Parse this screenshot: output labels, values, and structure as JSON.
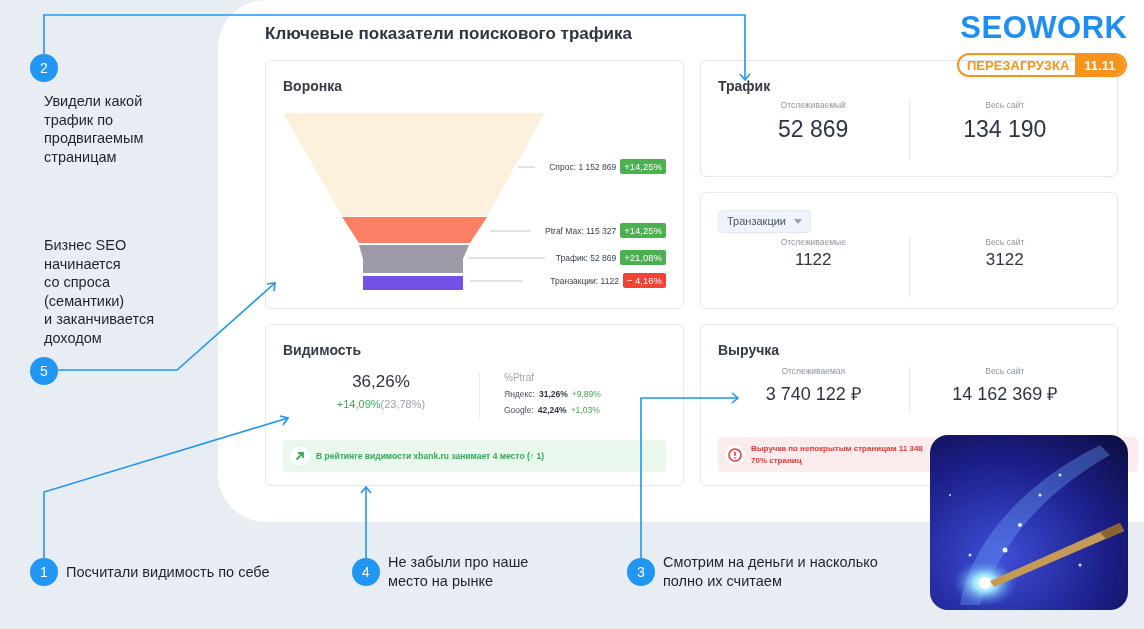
{
  "page_title": "Ключевые показатели поискового трафика",
  "logo": {
    "name": "SEOWORK",
    "badge_label": "ПЕРЕЗАГРУЗКА",
    "badge_date": "11.11"
  },
  "funnel": {
    "title": "Воронка",
    "stages": [
      {
        "label": "Спрос:",
        "value": "1 152 869",
        "change": "+14,25%",
        "negative": false,
        "color": "#fdf1de"
      },
      {
        "label": "Ptraf Max:",
        "value": "115 327",
        "change": "+14,25%",
        "negative": false,
        "color": "#fd7f66"
      },
      {
        "label": "Трафик:",
        "value": "52 869",
        "change": "+21,08%",
        "negative": false,
        "color": "#9e9aa8"
      },
      {
        "label": "Транзакции:",
        "value": "1122",
        "change": "− 4,16%",
        "negative": true,
        "color": "#7350e6"
      }
    ]
  },
  "traffic": {
    "title": "Трафик",
    "metrics": [
      {
        "label": "Отслеживаемый",
        "value": "52 869"
      },
      {
        "label": "Весь сайт",
        "value": "134 190"
      }
    ]
  },
  "transactions": {
    "dropdown": "Транзакции",
    "metrics": [
      {
        "label": "Отслеживаемые",
        "value": "1122"
      },
      {
        "label": "Весь сайт",
        "value": "3122"
      }
    ]
  },
  "visibility": {
    "title": "Видимость",
    "value": "36,26%",
    "change": "+14,09%",
    "previous": "(23,78%)",
    "breakdown_title": "%Ptraf",
    "engines": [
      {
        "label": "Яндекс:",
        "value": "31,26%",
        "change": "+9,89%"
      },
      {
        "label": "Google:",
        "value": "42,24%",
        "change": "+1,03%"
      }
    ],
    "rating_note": "В рейтинге видимости xbank.ru занимает 4 место (↑ 1)"
  },
  "revenue": {
    "title": "Выручка",
    "metrics": [
      {
        "label": "Отслеживаемая",
        "value": "3 740 122 ₽"
      },
      {
        "label": "Весь сайт",
        "value": "14 162 369 ₽"
      }
    ],
    "warning_lines": [
      "Выручка по непокрытым страницам 11 348",
      "70% страниц"
    ]
  },
  "callouts": [
    {
      "number": "2",
      "lines": [
        "Увидели какой",
        "трафик по",
        "продвигаемым",
        "страницам"
      ]
    },
    {
      "number": "5",
      "lines": [
        "Бизнес SEO",
        "начинается",
        "со спроса",
        "(семантики)",
        "и заканчивается",
        "доходом"
      ]
    },
    {
      "number": "1",
      "lines": [
        "Посчитали видимость по себе"
      ]
    },
    {
      "number": "4",
      "lines": [
        "Не забыли про наше",
        "место на рынке"
      ]
    },
    {
      "number": "3",
      "lines": [
        "Смотрим на деньги и насколько",
        "полно их считаем"
      ]
    }
  ]
}
